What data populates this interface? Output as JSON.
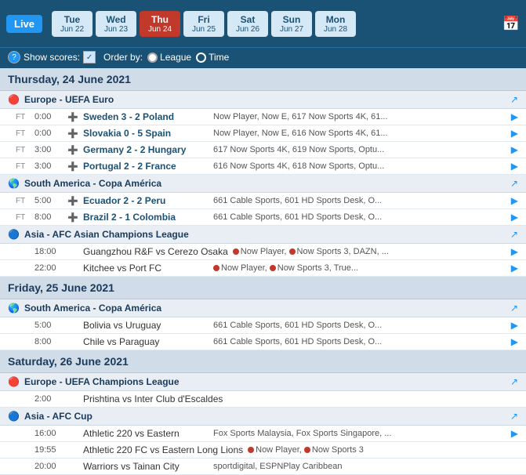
{
  "header": {
    "live_label": "Live",
    "calendar_icon": "📅",
    "days": [
      {
        "name": "Tue",
        "date": "Jun 22",
        "active": false
      },
      {
        "name": "Wed",
        "date": "Jun 23",
        "active": false
      },
      {
        "name": "Thu",
        "date": "Jun 24",
        "active": true
      },
      {
        "name": "Fri",
        "date": "Jun 25",
        "active": false
      },
      {
        "name": "Sat",
        "date": "Jun 26",
        "active": false
      },
      {
        "name": "Sun",
        "date": "Jun 27",
        "active": false
      },
      {
        "name": "Mon",
        "date": "Jun 28",
        "active": false
      }
    ]
  },
  "toolbar": {
    "show_scores_label": "Show scores:",
    "order_by_label": "Order by:",
    "league_label": "League",
    "time_label": "Time"
  },
  "sections": [
    {
      "date_header": "Thursday, 24 June 2021",
      "leagues": [
        {
          "name": "Europe - UEFA Euro",
          "region_icon": "🔴",
          "matches": [
            {
              "ft": "FT",
              "time": "0:00",
              "score_icon": true,
              "name": "Sweden 3 - 2 Poland",
              "channels": "Now Player, Now E, 617 Now Sports 4K, 61...",
              "has_arrow": true
            },
            {
              "ft": "FT",
              "time": "0:00",
              "score_icon": true,
              "name": "Slovakia 0 - 5 Spain",
              "channels": "Now Player, Now E, 616 Now Sports 4K, 61...",
              "has_arrow": true
            },
            {
              "ft": "FT",
              "time": "3:00",
              "score_icon": true,
              "name": "Germany 2 - 2 Hungary",
              "channels": "617 Now Sports 4K, 619 Now Sports, Optu...",
              "has_arrow": true
            },
            {
              "ft": "FT",
              "time": "3:00",
              "score_icon": true,
              "name": "Portugal 2 - 2 France",
              "channels": "616 Now Sports 4K, 618 Now Sports, Optu...",
              "has_arrow": true
            }
          ]
        },
        {
          "name": "South America - Copa América",
          "region_icon": "🌎",
          "matches": [
            {
              "ft": "FT",
              "time": "5:00",
              "score_icon": true,
              "name": "Ecuador 2 - 2 Peru",
              "channels": "661 Cable Sports, 601 HD Sports Desk, O...",
              "has_arrow": true
            },
            {
              "ft": "FT",
              "time": "8:00",
              "score_icon": true,
              "name": "Brazil 2 - 1 Colombia",
              "channels": "661 Cable Sports, 601 HD Sports Desk, O...",
              "has_arrow": true
            }
          ]
        },
        {
          "name": "Asia - AFC Asian Champions League",
          "region_icon": "🔵",
          "matches": [
            {
              "ft": "",
              "time": "18:00",
              "score_icon": false,
              "name": "Guangzhou R&F vs Cerezo Osaka",
              "channels_type": "red",
              "channels": "Now Player, Now Sports 3, DAZN, ...",
              "has_arrow": true
            },
            {
              "ft": "",
              "time": "22:00",
              "score_icon": false,
              "name": "Kitchee vs Port FC",
              "channels_type": "red",
              "channels": "Now Player, Now Sports 3, True...",
              "has_arrow": true
            }
          ]
        }
      ]
    },
    {
      "date_header": "Friday, 25 June 2021",
      "leagues": [
        {
          "name": "South America - Copa América",
          "region_icon": "🌎",
          "matches": [
            {
              "ft": "",
              "time": "5:00",
              "score_icon": false,
              "name": "Bolivia vs Uruguay",
              "channels": "661 Cable Sports, 601 HD Sports Desk, O...",
              "has_arrow": true
            },
            {
              "ft": "",
              "time": "8:00",
              "score_icon": false,
              "name": "Chile vs Paraguay",
              "channels": "661 Cable Sports, 601 HD Sports Desk, O...",
              "has_arrow": true
            }
          ]
        }
      ]
    },
    {
      "date_header": "Saturday, 26 June 2021",
      "leagues": [
        {
          "name": "Europe - UEFA Champions League",
          "region_icon": "🔴",
          "matches": [
            {
              "ft": "",
              "time": "2:00",
              "score_icon": false,
              "name": "Prishtina vs Inter Club d'Escaldes",
              "channels": "",
              "has_arrow": false
            }
          ]
        },
        {
          "name": "Asia - AFC Cup",
          "region_icon": "🔵",
          "matches": [
            {
              "ft": "",
              "time": "16:00",
              "score_icon": false,
              "name": "Athletic 220 vs Eastern",
              "channels": "Fox Sports Malaysia, Fox Sports Singapore, ...",
              "has_arrow": true
            },
            {
              "ft": "",
              "time": "19:55",
              "score_icon": false,
              "name": "Athletic 220 FC vs Eastern Long Lions",
              "channels_type": "red",
              "channels": "Now Player, Now Sports 3",
              "has_arrow": false
            },
            {
              "ft": "",
              "time": "20:00",
              "score_icon": false,
              "name": "Warriors vs Tainan City",
              "channels": "sportdigital, ESPNPlay Caribbean",
              "has_arrow": false
            }
          ]
        }
      ]
    }
  ]
}
